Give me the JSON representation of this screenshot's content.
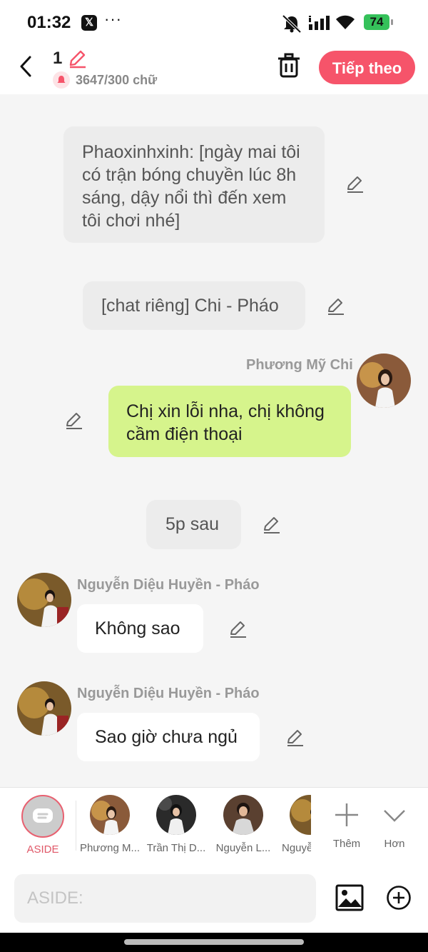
{
  "status_bar": {
    "time": "01:32",
    "x_badge": "𝕏",
    "more": "···",
    "battery": "74"
  },
  "header": {
    "title": "1",
    "counter": "3647/300 chữ",
    "next_button": "Tiếp theo",
    "accent_color": "#f6546a"
  },
  "messages": [
    {
      "type": "narration",
      "text": "Phaoxinhxinh: [ngày mai tôi có trận bóng chuyền lúc 8h sáng, dậy nổi thì đến xem tôi chơi nhé]"
    },
    {
      "type": "narration",
      "text": "[chat riêng] Chi - Pháo"
    },
    {
      "type": "outgoing",
      "sender": "Phương Mỹ Chi",
      "text": "Chị xin lỗi nha, chị không cầm điện thoại"
    },
    {
      "type": "narration",
      "text": "5p sau"
    },
    {
      "type": "incoming",
      "sender": "Nguyễn Diệu Huyền - Pháo",
      "text": "Không sao"
    },
    {
      "type": "incoming",
      "sender": "Nguyễn Diệu Huyền - Pháo",
      "text": "Sao giờ chưa ngủ"
    }
  ],
  "tray": {
    "aside_label": "ASIDE",
    "characters": [
      "Phương M...",
      "Trần Thị D...",
      "Nguyễn L...",
      "Nguyễ"
    ],
    "add_label": "Thêm",
    "more_label": "Hơn"
  },
  "input": {
    "placeholder": "ASIDE:"
  }
}
